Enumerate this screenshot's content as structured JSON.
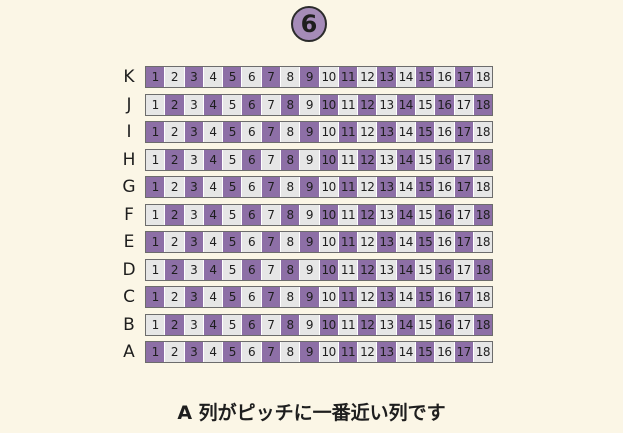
{
  "badge_number": "6",
  "caption": "A 列がピッチに一番近い列です",
  "colors": {
    "background": "#fbf6e6",
    "seat_purple": "#8d6fa6",
    "seat_gray": "#e6e6e6",
    "badge": "#a58bb8"
  },
  "seat_numbers": [
    "1",
    "2",
    "3",
    "4",
    "5",
    "6",
    "7",
    "8",
    "9",
    "10",
    "11",
    "12",
    "13",
    "14",
    "15",
    "16",
    "17",
    "18"
  ],
  "rows": [
    {
      "label": "K",
      "purple_seats": [
        1,
        3,
        5,
        7,
        9,
        11,
        13,
        15,
        17
      ]
    },
    {
      "label": "J",
      "purple_seats": [
        2,
        4,
        6,
        8,
        10,
        12,
        14,
        16,
        18
      ]
    },
    {
      "label": "I",
      "purple_seats": [
        1,
        3,
        5,
        7,
        9,
        11,
        13,
        15,
        17
      ]
    },
    {
      "label": "H",
      "purple_seats": [
        2,
        4,
        6,
        8,
        10,
        12,
        14,
        16,
        18
      ]
    },
    {
      "label": "G",
      "purple_seats": [
        1,
        3,
        5,
        7,
        9,
        11,
        13,
        15,
        17
      ]
    },
    {
      "label": "F",
      "purple_seats": [
        2,
        4,
        6,
        8,
        10,
        12,
        14,
        16,
        18
      ]
    },
    {
      "label": "E",
      "purple_seats": [
        1,
        3,
        5,
        7,
        9,
        11,
        13,
        15,
        17
      ]
    },
    {
      "label": "D",
      "purple_seats": [
        2,
        4,
        6,
        8,
        10,
        12,
        14,
        16,
        18
      ]
    },
    {
      "label": "C",
      "purple_seats": [
        1,
        3,
        5,
        7,
        9,
        11,
        13,
        15,
        17
      ]
    },
    {
      "label": "B",
      "purple_seats": [
        2,
        4,
        6,
        8,
        10,
        12,
        14,
        16,
        18
      ]
    },
    {
      "label": "A",
      "purple_seats": [
        1,
        3,
        5,
        7,
        9,
        11,
        13,
        15,
        17
      ]
    }
  ]
}
